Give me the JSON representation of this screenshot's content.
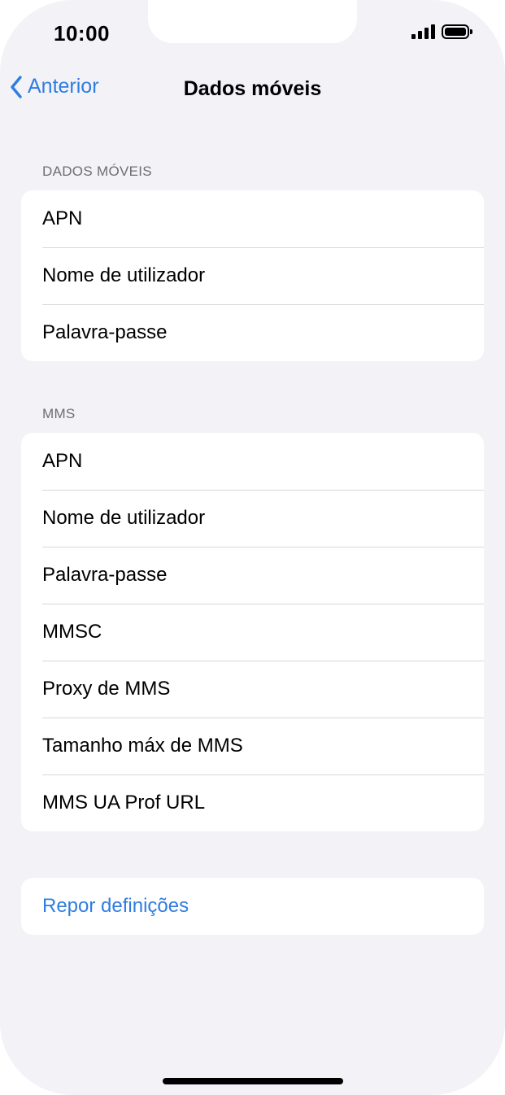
{
  "status_bar": {
    "time": "10:00",
    "signal_icon": "cellular-signal-icon",
    "battery_icon": "battery-icon"
  },
  "nav": {
    "back_label": "Anterior",
    "back_icon": "chevron-left-icon",
    "title": "Dados móveis"
  },
  "sections": {
    "dados_moveis": {
      "header": "DADOS MÓVEIS",
      "rows": [
        "APN",
        "Nome de utilizador",
        "Palavra-passe"
      ]
    },
    "mms": {
      "header": "MMS",
      "rows": [
        "APN",
        "Nome de utilizador",
        "Palavra-passe",
        "MMSC",
        "Proxy de MMS",
        "Tamanho máx de MMS",
        "MMS UA Prof URL"
      ]
    },
    "reset": {
      "label": "Repor definições"
    }
  },
  "colors": {
    "accent": "#2f7de1",
    "background": "#f2f2f7",
    "card": "#ffffff",
    "separator": "#d8d8dc",
    "section_header": "#6d6d72"
  }
}
